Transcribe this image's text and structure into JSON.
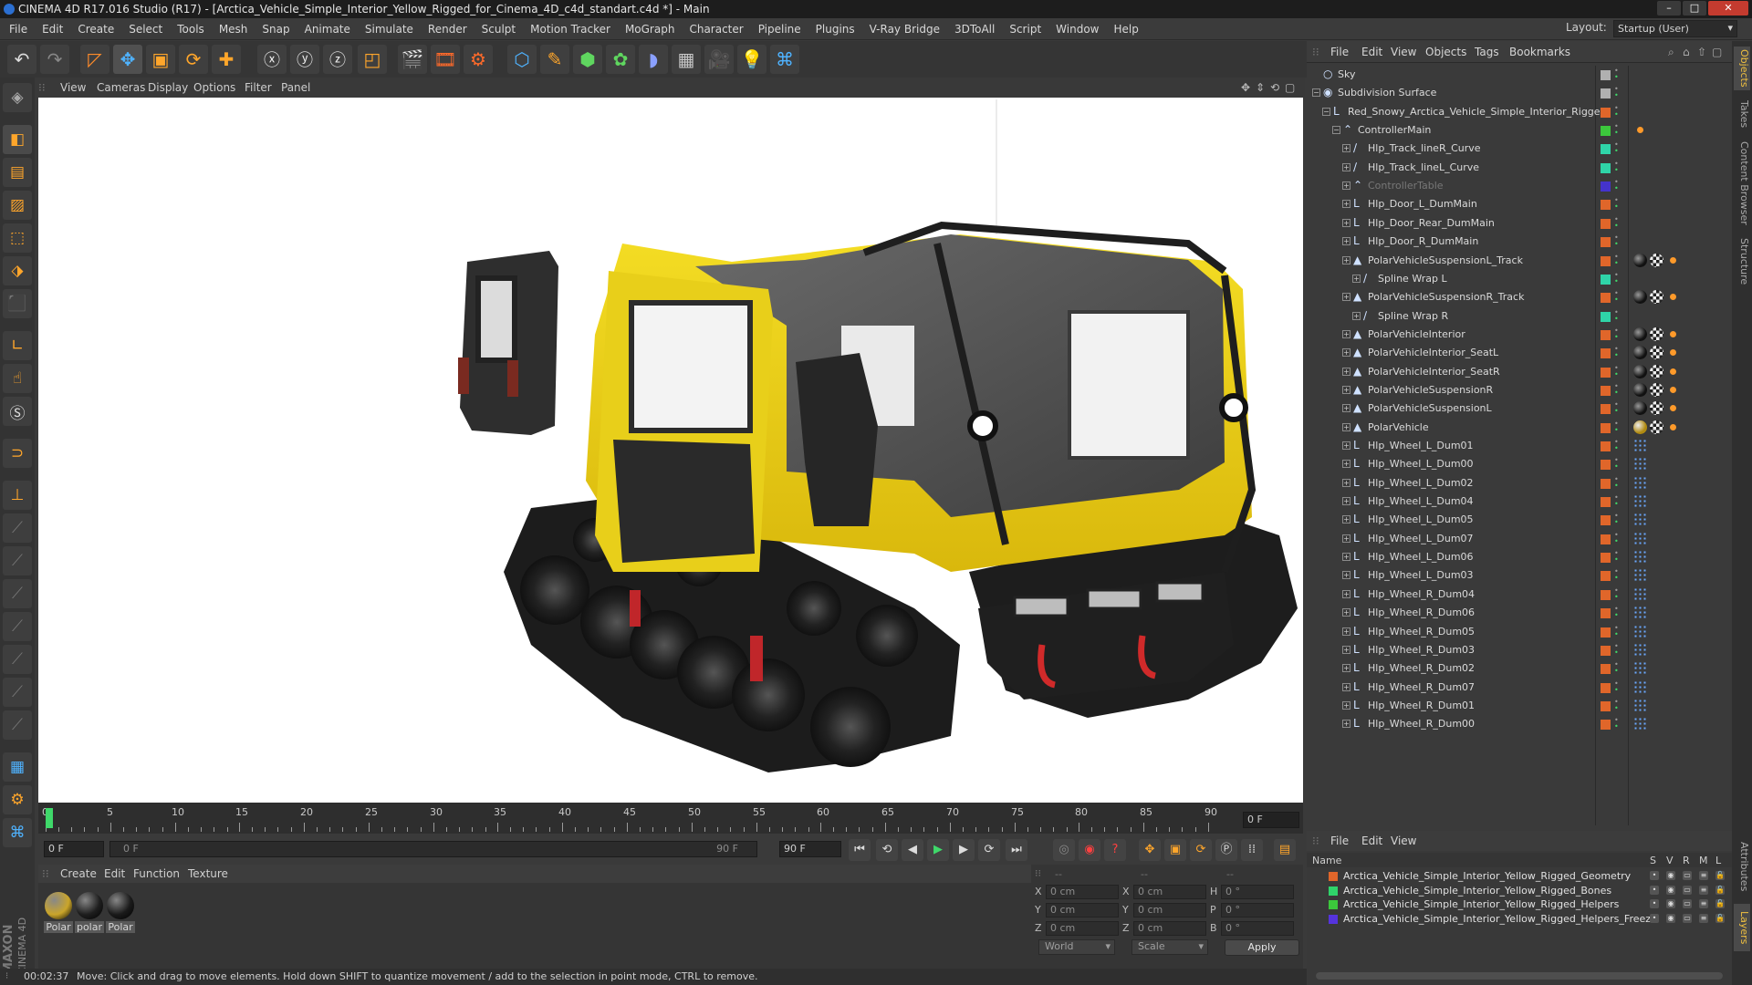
{
  "window": {
    "title": "CINEMA 4D R17.016 Studio (R17) - [Arctica_Vehicle_Simple_Interior_Yellow_Rigged_for_Cinema_4D_c4d_standart.c4d *] - Main"
  },
  "menubar": {
    "items": [
      "File",
      "Edit",
      "Create",
      "Select",
      "Tools",
      "Mesh",
      "Snap",
      "Animate",
      "Simulate",
      "Render",
      "Sculpt",
      "Motion Tracker",
      "MoGraph",
      "Character",
      "Pipeline",
      "Plugins",
      "V-Ray Bridge",
      "3DToAll",
      "Script",
      "Window",
      "Help"
    ],
    "layout_label": "Layout:",
    "layout_value": "Startup (User)"
  },
  "viewport": {
    "menu": [
      "View",
      "Cameras",
      "Display",
      "Options",
      "Filter",
      "Panel"
    ]
  },
  "timeline": {
    "ticks": [
      "0",
      "5",
      "10",
      "15",
      "20",
      "25",
      "30",
      "35",
      "40",
      "45",
      "50",
      "55",
      "60",
      "65",
      "70",
      "75",
      "80",
      "85",
      "90"
    ],
    "current_frame": "0 F"
  },
  "transport": {
    "start_field": "0 F",
    "range_start": "0 F",
    "range_end": "90 F",
    "end_field": "90 F"
  },
  "materials": {
    "menu": [
      "Create",
      "Edit",
      "Function",
      "Texture"
    ],
    "items": [
      {
        "label": "Polar",
        "color": "#caa52a"
      },
      {
        "label": "polar",
        "color": "#1e1e1e"
      },
      {
        "label": "Polar",
        "color": "#1a1a1a"
      }
    ]
  },
  "coordinates": {
    "header": [
      "--",
      "--",
      "--"
    ],
    "rows": [
      {
        "a": "X",
        "av": "0 cm",
        "b": "X",
        "bv": "0 cm",
        "c": "H",
        "cv": "0 °"
      },
      {
        "a": "Y",
        "av": "0 cm",
        "b": "Y",
        "bv": "0 cm",
        "c": "P",
        "cv": "0 °"
      },
      {
        "a": "Z",
        "av": "0 cm",
        "b": "Z",
        "bv": "0 cm",
        "c": "B",
        "cv": "0 °"
      }
    ],
    "mode": "World",
    "scale": "Scale",
    "apply": "Apply"
  },
  "status": {
    "time": "00:02:37",
    "message": "Move: Click and drag to move elements. Hold down SHIFT to quantize movement / add to the selection in point mode, CTRL to remove."
  },
  "object_manager": {
    "menu": [
      "File",
      "Edit",
      "View",
      "Objects",
      "Tags",
      "Bookmarks"
    ],
    "objects": [
      {
        "name": "Sky",
        "depth": 0,
        "icon": "sky-icon",
        "glyph": "○",
        "color": "#b0b0b0",
        "tags": []
      },
      {
        "name": "Subdivision Surface",
        "depth": 0,
        "icon": "subdivision-icon",
        "glyph": "◉",
        "color": "#b0b0b0",
        "tags": []
      },
      {
        "name": "Red_Snowy_Arctica_Vehicle_Simple_Interior_Rigged",
        "depth": 1,
        "icon": "null-icon",
        "glyph": "L",
        "color": "#e0662a",
        "tags": []
      },
      {
        "name": "ControllerMain",
        "depth": 2,
        "icon": "spline-icon",
        "glyph": "⌃",
        "color": "#3cc83c",
        "tags": [
          "orange"
        ]
      },
      {
        "name": "Hlp_Track_lineR_Curve",
        "depth": 3,
        "icon": "spline-icon",
        "glyph": "∕",
        "color": "#2fd4a8",
        "tags": []
      },
      {
        "name": "Hlp_Track_lineL_Curve",
        "depth": 3,
        "icon": "spline-icon",
        "glyph": "∕",
        "color": "#2fd4a8",
        "tags": []
      },
      {
        "name": "ControllerTable",
        "depth": 3,
        "icon": "spline-icon",
        "glyph": "⌃",
        "color": "#4433cc",
        "tags": [],
        "dim": true
      },
      {
        "name": "Hlp_Door_L_DumMain",
        "depth": 3,
        "icon": "null-icon",
        "glyph": "L",
        "color": "#e0662a",
        "tags": []
      },
      {
        "name": "Hlp_Door_Rear_DumMain",
        "depth": 3,
        "icon": "null-icon",
        "glyph": "L",
        "color": "#e0662a",
        "tags": []
      },
      {
        "name": "Hlp_Door_R_DumMain",
        "depth": 3,
        "icon": "null-icon",
        "glyph": "L",
        "color": "#e0662a",
        "tags": []
      },
      {
        "name": "PolarVehicleSuspensionL_Track",
        "depth": 3,
        "icon": "polygon-icon",
        "glyph": "▲",
        "color": "#e0662a",
        "tags": [
          "black",
          "checker",
          "orange"
        ]
      },
      {
        "name": "Spline Wrap L",
        "depth": 4,
        "icon": "spline-wrap-icon",
        "glyph": "∕",
        "color": "#2fd4a8",
        "tags": []
      },
      {
        "name": "PolarVehicleSuspensionR_Track",
        "depth": 3,
        "icon": "polygon-icon",
        "glyph": "▲",
        "color": "#e0662a",
        "tags": [
          "black",
          "checker",
          "orange"
        ]
      },
      {
        "name": "Spline Wrap R",
        "depth": 4,
        "icon": "spline-wrap-icon",
        "glyph": "∕",
        "color": "#2fd4a8",
        "tags": []
      },
      {
        "name": "PolarVehicleInterior",
        "depth": 3,
        "icon": "polygon-icon",
        "glyph": "▲",
        "color": "#e0662a",
        "tags": [
          "black",
          "checker",
          "orange"
        ]
      },
      {
        "name": "PolarVehicleInterior_SeatL",
        "depth": 3,
        "icon": "polygon-icon",
        "glyph": "▲",
        "color": "#e0662a",
        "tags": [
          "black",
          "checker",
          "orange"
        ]
      },
      {
        "name": "PolarVehicleInterior_SeatR",
        "depth": 3,
        "icon": "polygon-icon",
        "glyph": "▲",
        "color": "#e0662a",
        "tags": [
          "black",
          "checker",
          "orange"
        ]
      },
      {
        "name": "PolarVehicleSuspensionR",
        "depth": 3,
        "icon": "polygon-icon",
        "glyph": "▲",
        "color": "#e0662a",
        "tags": [
          "black",
          "checker",
          "orange"
        ]
      },
      {
        "name": "PolarVehicleSuspensionL",
        "depth": 3,
        "icon": "polygon-icon",
        "glyph": "▲",
        "color": "#e0662a",
        "tags": [
          "black",
          "checker",
          "orange"
        ]
      },
      {
        "name": "PolarVehicle",
        "depth": 3,
        "icon": "polygon-icon",
        "glyph": "▲",
        "color": "#e0662a",
        "tags": [
          "yellow",
          "checker",
          "orange"
        ]
      },
      {
        "name": "Hlp_Wheel_L_Dum01",
        "depth": 3,
        "icon": "null-icon",
        "glyph": "L",
        "color": "#e0662a",
        "tags": [
          "dots"
        ]
      },
      {
        "name": "Hlp_Wheel_L_Dum00",
        "depth": 3,
        "icon": "null-icon",
        "glyph": "L",
        "color": "#e0662a",
        "tags": [
          "dots"
        ]
      },
      {
        "name": "Hlp_Wheel_L_Dum02",
        "depth": 3,
        "icon": "null-icon",
        "glyph": "L",
        "color": "#e0662a",
        "tags": [
          "dots"
        ]
      },
      {
        "name": "Hlp_Wheel_L_Dum04",
        "depth": 3,
        "icon": "null-icon",
        "glyph": "L",
        "color": "#e0662a",
        "tags": [
          "dots"
        ]
      },
      {
        "name": "Hlp_Wheel_L_Dum05",
        "depth": 3,
        "icon": "null-icon",
        "glyph": "L",
        "color": "#e0662a",
        "tags": [
          "dots"
        ]
      },
      {
        "name": "Hlp_Wheel_L_Dum07",
        "depth": 3,
        "icon": "null-icon",
        "glyph": "L",
        "color": "#e0662a",
        "tags": [
          "dots"
        ]
      },
      {
        "name": "Hlp_Wheel_L_Dum06",
        "depth": 3,
        "icon": "null-icon",
        "glyph": "L",
        "color": "#e0662a",
        "tags": [
          "dots"
        ]
      },
      {
        "name": "Hlp_Wheel_L_Dum03",
        "depth": 3,
        "icon": "null-icon",
        "glyph": "L",
        "color": "#e0662a",
        "tags": [
          "dots"
        ]
      },
      {
        "name": "Hlp_Wheel_R_Dum04",
        "depth": 3,
        "icon": "null-icon",
        "glyph": "L",
        "color": "#e0662a",
        "tags": [
          "dots"
        ]
      },
      {
        "name": "Hlp_Wheel_R_Dum06",
        "depth": 3,
        "icon": "null-icon",
        "glyph": "L",
        "color": "#e0662a",
        "tags": [
          "dots"
        ]
      },
      {
        "name": "Hlp_Wheel_R_Dum05",
        "depth": 3,
        "icon": "null-icon",
        "glyph": "L",
        "color": "#e0662a",
        "tags": [
          "dots"
        ]
      },
      {
        "name": "Hlp_Wheel_R_Dum03",
        "depth": 3,
        "icon": "null-icon",
        "glyph": "L",
        "color": "#e0662a",
        "tags": [
          "dots"
        ]
      },
      {
        "name": "Hlp_Wheel_R_Dum02",
        "depth": 3,
        "icon": "null-icon",
        "glyph": "L",
        "color": "#e0662a",
        "tags": [
          "dots"
        ]
      },
      {
        "name": "Hlp_Wheel_R_Dum07",
        "depth": 3,
        "icon": "null-icon",
        "glyph": "L",
        "color": "#e0662a",
        "tags": [
          "dots"
        ]
      },
      {
        "name": "Hlp_Wheel_R_Dum01",
        "depth": 3,
        "icon": "null-icon",
        "glyph": "L",
        "color": "#e0662a",
        "tags": [
          "dots"
        ]
      },
      {
        "name": "Hlp_Wheel_R_Dum00",
        "depth": 3,
        "icon": "null-icon",
        "glyph": "L",
        "color": "#e0662a",
        "tags": [
          "dots"
        ]
      }
    ]
  },
  "layers": {
    "menu": [
      "File",
      "Edit",
      "View"
    ],
    "columns": [
      "Name",
      "S",
      "V",
      "R",
      "M",
      "L"
    ],
    "items": [
      {
        "name": "Arctica_Vehicle_Simple_Interior_Yellow_Rigged_Geometry",
        "color": "#e0662a"
      },
      {
        "name": "Arctica_Vehicle_Simple_Interior_Yellow_Rigged_Bones",
        "color": "#2fd46a"
      },
      {
        "name": "Arctica_Vehicle_Simple_Interior_Yellow_Rigged_Helpers",
        "color": "#3cc83c"
      },
      {
        "name": "Arctica_Vehicle_Simple_Interior_Yellow_Rigged_Helpers_Freeze",
        "color": "#5533dd"
      }
    ]
  },
  "side_tabs": [
    "Objects",
    "Takes",
    "Content Browser",
    "Structure",
    "Attributes",
    "Layers"
  ]
}
